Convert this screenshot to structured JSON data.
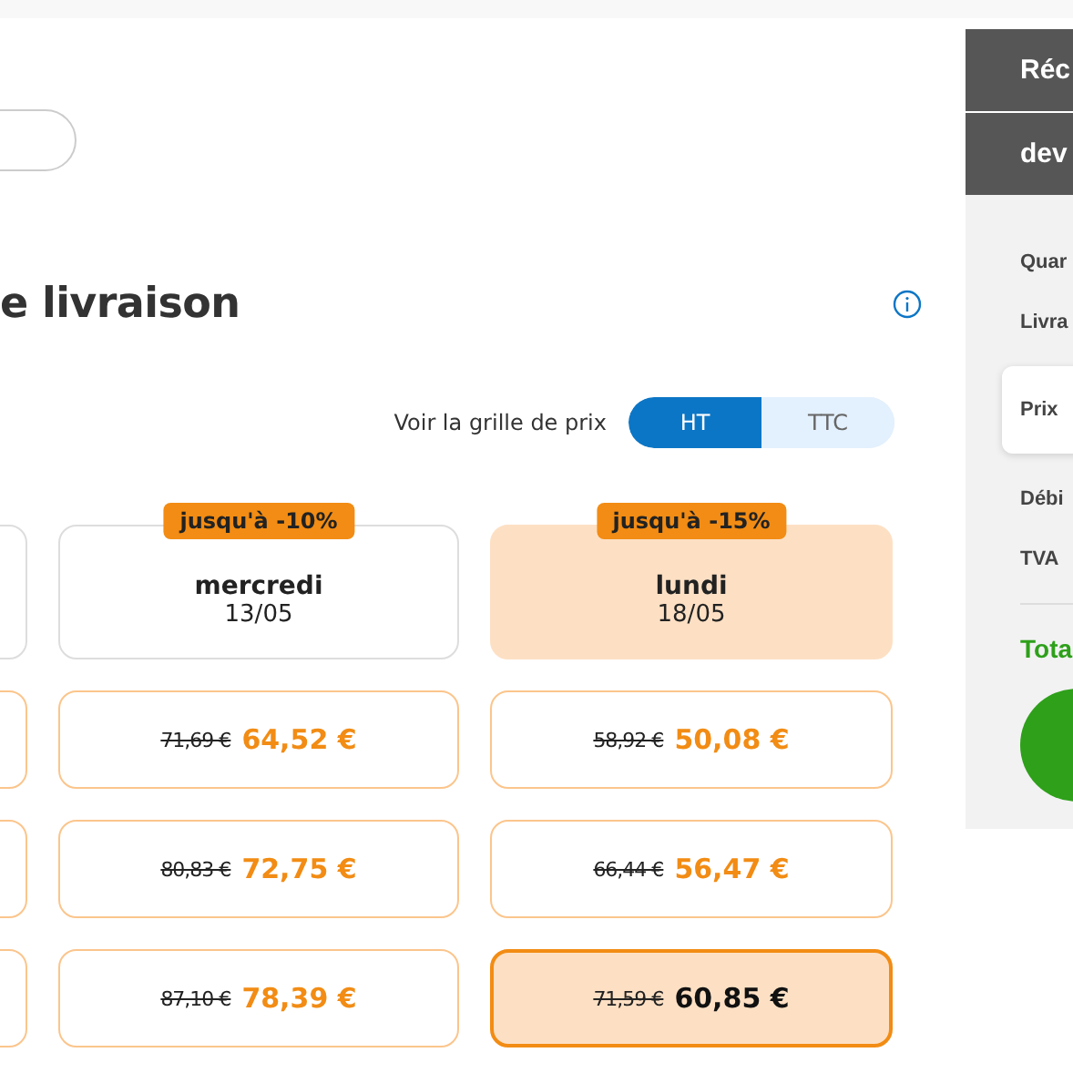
{
  "heading": "e livraison",
  "price_toggle": {
    "label": "Voir la grille de prix",
    "options": [
      {
        "label": "HT",
        "selected": true
      },
      {
        "label": "TTC",
        "selected": false
      }
    ]
  },
  "columns": [
    {
      "highlighted": false,
      "prices": [
        {
          "selected": false
        },
        {
          "selected": false
        },
        {
          "selected": false
        }
      ]
    },
    {
      "badge": "jusqu'à -10%",
      "day": "mercredi",
      "date": "13/05",
      "highlighted": false,
      "prices": [
        {
          "old": "71,69 €",
          "new": "64,52 €",
          "selected": false
        },
        {
          "old": "80,83 €",
          "new": "72,75 €",
          "selected": false
        },
        {
          "old": "87,10 €",
          "new": "78,39 €",
          "selected": false
        }
      ]
    },
    {
      "badge": "jusqu'à -15%",
      "day": "lundi",
      "date": "18/05",
      "highlighted": true,
      "prices": [
        {
          "old": "58,92 €",
          "new": "50,08 €",
          "selected": false
        },
        {
          "old": "66,44 €",
          "new": "56,47 €",
          "selected": false
        },
        {
          "old": "71,59 €",
          "new": "60,85 €",
          "selected": true
        }
      ]
    }
  ],
  "summary": {
    "header_lines": [
      "Réc",
      "dev"
    ],
    "rows": [
      {
        "label": "Quar",
        "selected": false
      },
      {
        "label": "Livra",
        "selected": false
      },
      {
        "label": "Prix",
        "selected": true
      },
      {
        "label": "Débi",
        "selected": false
      },
      {
        "label": "TVA",
        "selected": false
      }
    ],
    "total": "Tota"
  }
}
